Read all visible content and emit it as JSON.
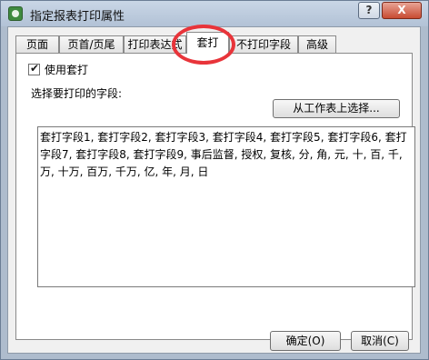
{
  "window": {
    "title": "指定报表打印属性",
    "help_label": "?",
    "close_label": "X"
  },
  "tabs": [
    {
      "label": "页面"
    },
    {
      "label": "页首/页尾"
    },
    {
      "label": "打印表达式"
    },
    {
      "label": "套打"
    },
    {
      "label": "不打印字段"
    },
    {
      "label": "高级"
    }
  ],
  "active_tab": 3,
  "use_template": {
    "label": "使用套打",
    "checked": true
  },
  "field_group": {
    "label": "选择要打印的字段:"
  },
  "select_from_sheet_label": "从工作表上选择...",
  "fields_text": "套打字段1, 套打字段2, 套打字段3, 套打字段4, 套打字段5, 套打字段6, 套打字段7, 套打字段8, 套打字段9, 事后监督, 授权, 复核, 分, 角, 元, 十, 百, 千, 万, 十万, 百万, 千万, 亿, 年, 月, 日",
  "footer": {
    "ok_label": "确定(O)",
    "cancel_label": "取消(C)"
  },
  "colors": {
    "annotation_circle": "#e8343a",
    "titlebar": "#b9c8da"
  }
}
